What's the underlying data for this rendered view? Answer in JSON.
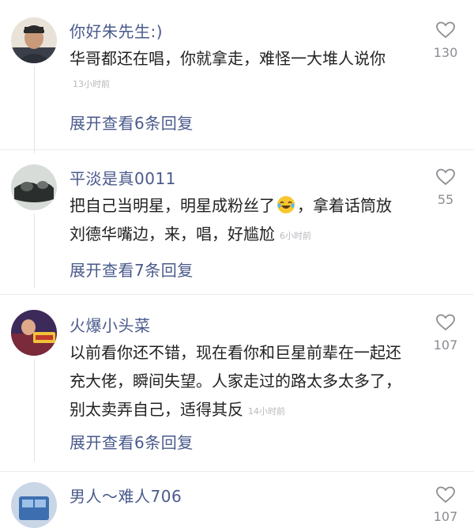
{
  "comments": [
    {
      "username": "你好朱先生:)",
      "text_lines": [
        "华哥都还在唱，你就拿走，难怪一大堆人说你"
      ],
      "timestamp": "13小时前",
      "likes": "130",
      "replies_label": "展开查看6条回复"
    },
    {
      "username": "平淡是真0011",
      "text_lines": [
        "把自己当明星，明星成粉丝了",
        "，拿着话筒放",
        "刘德华嘴边，来，唱，好尴尬"
      ],
      "emoji": "laughing-tears-emoji",
      "timestamp": "6小时前",
      "likes": "55",
      "replies_label": "展开查看7条回复"
    },
    {
      "username": "火爆小头菜",
      "text_lines": [
        "以前看你还不错，现在看你和巨星前辈在一起还",
        "充大佬，瞬间失望。人家走过的路太多太多了，",
        "别太卖弄自己，适得其反"
      ],
      "timestamp": "14小时前",
      "likes": "107",
      "replies_label": "展开查看6条回复"
    },
    {
      "username": "男人～难人706",
      "likes": "107"
    }
  ],
  "icons": {
    "like": "heart-outline-icon"
  },
  "colors": {
    "username": "#4a5a8c",
    "text": "#222222",
    "meta": "#b8b8bd",
    "like": "#8c8c92"
  }
}
